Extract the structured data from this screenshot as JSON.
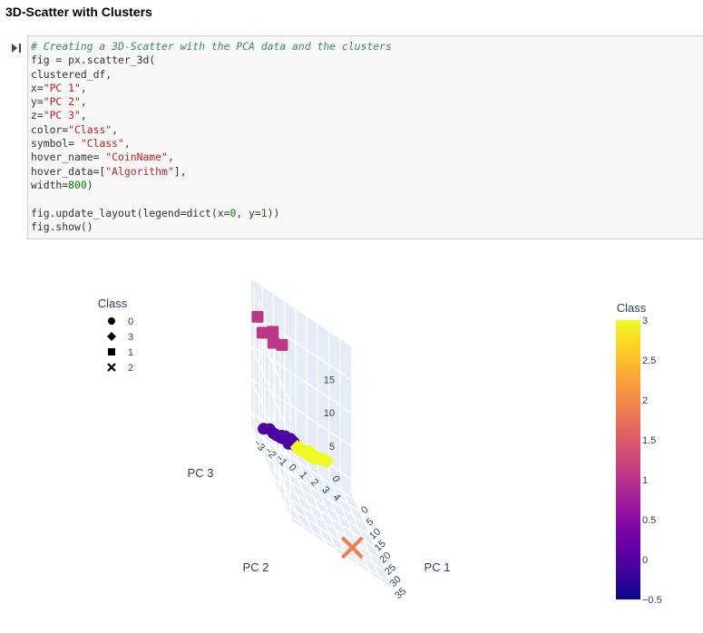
{
  "section_title": "3D-Scatter with Clusters",
  "code": {
    "comment": "# Creating a 3D-Scatter with the PCA data and the clusters",
    "lines": [
      [
        {
          "t": "fig = px.scatter_3d("
        }
      ],
      [
        {
          "t": "clustered_df,"
        }
      ],
      [
        {
          "t": "x="
        },
        {
          "t": "\"PC 1\"",
          "c": "str"
        },
        {
          "t": ","
        }
      ],
      [
        {
          "t": "y="
        },
        {
          "t": "\"PC 2\"",
          "c": "str"
        },
        {
          "t": ","
        }
      ],
      [
        {
          "t": "z="
        },
        {
          "t": "\"PC 3\"",
          "c": "str"
        },
        {
          "t": ","
        }
      ],
      [
        {
          "t": "color="
        },
        {
          "t": "\"Class\"",
          "c": "str"
        },
        {
          "t": ","
        }
      ],
      [
        {
          "t": "symbol= "
        },
        {
          "t": "\"Class\"",
          "c": "str"
        },
        {
          "t": ","
        }
      ],
      [
        {
          "t": "hover_name= "
        },
        {
          "t": "\"CoinName\"",
          "c": "str"
        },
        {
          "t": ","
        }
      ],
      [
        {
          "t": "hover_data=["
        },
        {
          "t": "\"Algorithm\"",
          "c": "str"
        },
        {
          "t": "],"
        }
      ],
      [
        {
          "t": "width="
        },
        {
          "t": "800",
          "c": "num"
        },
        {
          "t": ")"
        }
      ],
      [
        {
          "t": ""
        }
      ],
      [
        {
          "t": "fig.update_layout(legend=dict(x="
        },
        {
          "t": "0",
          "c": "num"
        },
        {
          "t": ", y="
        },
        {
          "t": "1",
          "c": "num"
        },
        {
          "t": "))"
        }
      ],
      [
        {
          "t": "fig.show()"
        }
      ]
    ]
  },
  "chart_data": {
    "type": "scatter",
    "projection": "3d",
    "legend_title": "Class",
    "legend_items": [
      {
        "label": "0",
        "symbol": "circle"
      },
      {
        "label": "3",
        "symbol": "diamond"
      },
      {
        "label": "1",
        "symbol": "square"
      },
      {
        "label": "2",
        "symbol": "x"
      }
    ],
    "xlabel": "PC 1",
    "ylabel": "PC 2",
    "zlabel": "PC 3",
    "xticks": [
      "0",
      "5",
      "10",
      "15",
      "20",
      "25",
      "30",
      "35"
    ],
    "yticks": [
      "−3",
      "−2",
      "−1",
      "0",
      "1",
      "2",
      "3",
      "4"
    ],
    "zticks": [
      "0",
      "5",
      "10",
      "15"
    ],
    "xlim": [
      -3,
      37
    ],
    "ylim": [
      -4,
      5
    ],
    "zlim": [
      -2,
      20
    ],
    "colorbar": {
      "title": "Class",
      "ticks": [
        "3",
        "2.5",
        "2",
        "1.5",
        "1",
        "0.5",
        "0",
        "−0.5"
      ],
      "range": [
        -0.5,
        3
      ],
      "colors": [
        "#0d0887",
        "#46039f",
        "#7201a8",
        "#9c179e",
        "#bd3786",
        "#d8576b",
        "#ed7953",
        "#fb9f3a",
        "#fdca26",
        "#f0f921"
      ]
    },
    "series": [
      {
        "name": "0",
        "symbol": "circle",
        "color": "#4f02a2",
        "points": [
          [
            -0.2,
            -0.5,
            0.3
          ],
          [
            -0.3,
            -0.3,
            0.1
          ],
          [
            -0.1,
            -0.6,
            0.5
          ],
          [
            0.0,
            -0.8,
            0.4
          ],
          [
            -0.2,
            -1.0,
            0.2
          ],
          [
            -0.4,
            -0.7,
            0.6
          ],
          [
            0.1,
            -1.3,
            0.1
          ],
          [
            -0.3,
            -1.5,
            0.2
          ],
          [
            0.0,
            -1.6,
            -0.1
          ],
          [
            0.2,
            -1.8,
            0.0
          ],
          [
            -0.1,
            -2.0,
            -0.2
          ],
          [
            0.3,
            -2.3,
            -0.1
          ],
          [
            -0.2,
            -1.2,
            0.5
          ],
          [
            -0.5,
            -0.4,
            0.4
          ],
          [
            0.1,
            -0.9,
            -0.2
          ],
          [
            -0.2,
            -2.6,
            0.0
          ],
          [
            0.0,
            -1.1,
            0.2
          ],
          [
            0.4,
            -3.2,
            -0.4
          ]
        ]
      },
      {
        "name": "3",
        "symbol": "diamond",
        "color": "#f0f921",
        "points": [
          [
            -0.4,
            2.0,
            0.6
          ],
          [
            -0.3,
            1.6,
            0.4
          ],
          [
            -0.5,
            1.3,
            0.5
          ],
          [
            -0.2,
            1.1,
            0.3
          ],
          [
            -0.6,
            2.3,
            0.8
          ],
          [
            -0.3,
            0.8,
            0.2
          ],
          [
            -0.4,
            0.5,
            0.1
          ],
          [
            -0.2,
            0.3,
            0.0
          ],
          [
            -0.5,
            1.8,
            0.5
          ],
          [
            -0.3,
            1.4,
            0.1
          ],
          [
            -0.6,
            2.6,
            0.9
          ],
          [
            -0.4,
            0.9,
            -0.1
          ],
          [
            -0.2,
            0.7,
            0.3
          ],
          [
            -0.5,
            0.2,
            0.2
          ],
          [
            -0.3,
            1.0,
            0.6
          ],
          [
            -0.2,
            -0.1,
            0.1
          ],
          [
            -0.6,
            0.0,
            -0.2
          ]
        ]
      },
      {
        "name": "1",
        "symbol": "square",
        "color": "#bd3786",
        "points": [
          [
            0.5,
            -3.3,
            14.0
          ],
          [
            1.0,
            -3.8,
            16.0
          ],
          [
            0.2,
            -2.3,
            13.5
          ],
          [
            0.0,
            -1.5,
            14.0
          ],
          [
            1.8,
            -2.5,
            15.5
          ]
        ]
      },
      {
        "name": "2",
        "symbol": "x",
        "color": "#ef7f4f",
        "points": [
          [
            33.0,
            1.8,
            -1.0
          ]
        ]
      }
    ]
  }
}
